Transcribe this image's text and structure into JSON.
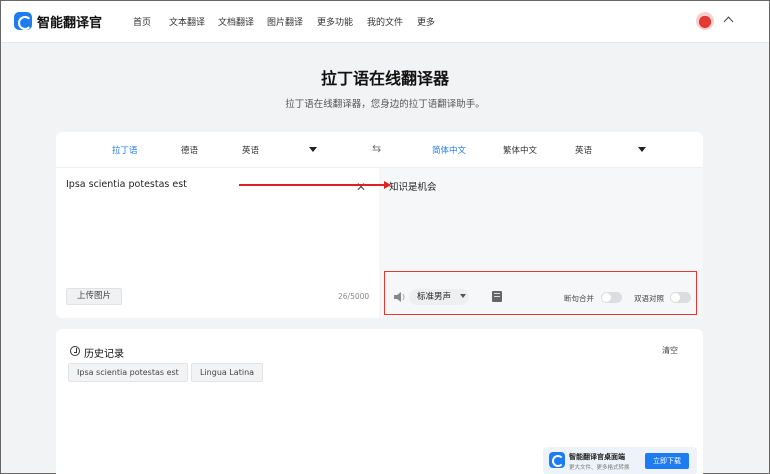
{
  "app": {
    "name": "智能翻译官"
  },
  "nav": {
    "items": [
      "首页",
      "文本翻译",
      "文档翻译",
      "图片翻译",
      "更多功能",
      "我的文件",
      "更多"
    ]
  },
  "hero": {
    "title": "拉丁语在线翻译器",
    "subtitle": "拉丁语在线翻译器，您身边的拉丁语翻译助手。"
  },
  "source_langs": [
    "拉丁语",
    "德语",
    "英语"
  ],
  "target_langs": [
    "简体中文",
    "繁体中文",
    "英语"
  ],
  "input": {
    "text": "Ipsa scientia potestas est",
    "counter": "26/5000",
    "upload_label": "上传图片"
  },
  "output": {
    "text": "知识是机会"
  },
  "tools": {
    "voice": "标准男声",
    "toggle1": "断句合并",
    "toggle2": "双语对照"
  },
  "history": {
    "title": "历史记录",
    "clear": "清空",
    "chips": [
      "Ipsa scientia potestas est",
      "Lingua Latina"
    ]
  },
  "promo": {
    "title": "智能翻译官桌面端",
    "sub": "更大文件、更多格式转换",
    "button": "立即下载"
  },
  "colors": {
    "accent": "#1e7cf2",
    "annotation": "#dd2222"
  }
}
